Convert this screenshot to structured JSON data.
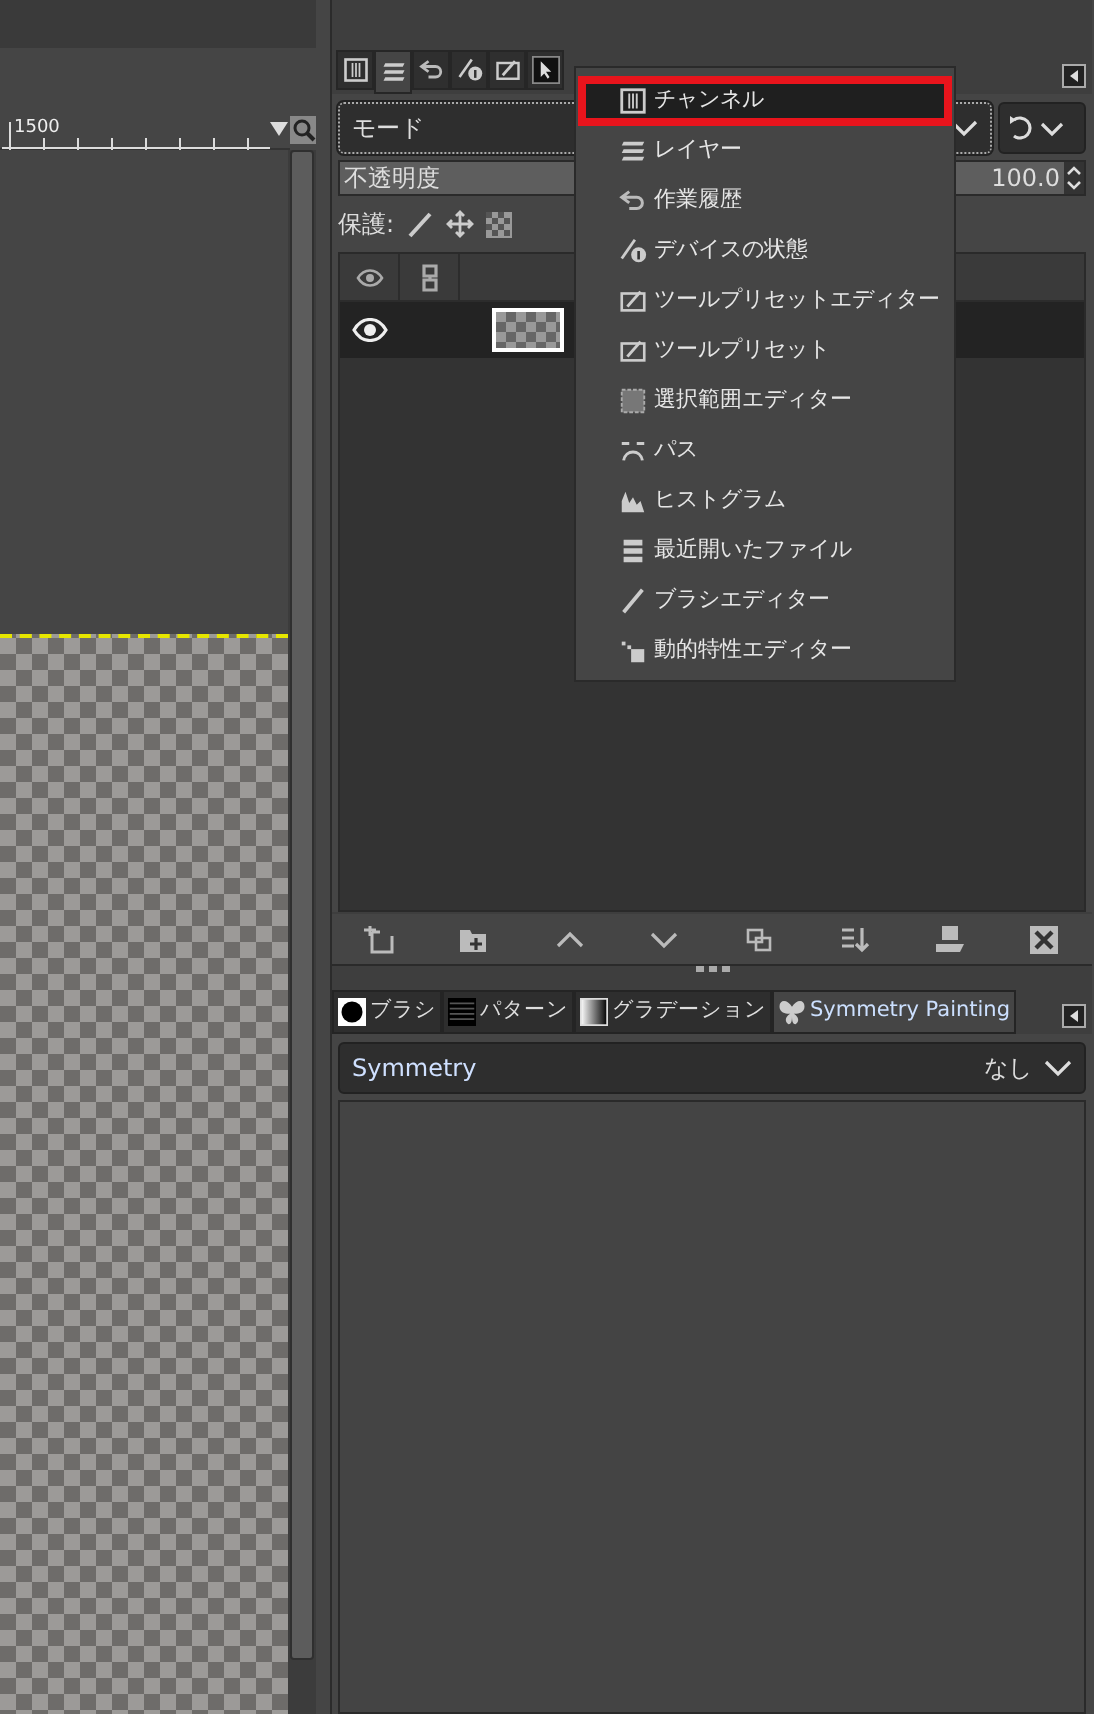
{
  "ruler": {
    "label": "1500"
  },
  "dock_tabs": [
    {
      "kind": "channels",
      "selected": false
    },
    {
      "kind": "layers",
      "selected": true
    },
    {
      "kind": "undo",
      "selected": false
    },
    {
      "kind": "device",
      "selected": false
    },
    {
      "kind": "preset",
      "selected": false
    },
    {
      "kind": "pointer",
      "selected": false
    }
  ],
  "mode_field": {
    "value": "モード"
  },
  "opacity": {
    "label": "不透明度",
    "value": "100.0",
    "level": 1.0
  },
  "lock": {
    "label": "保護:"
  },
  "layers": [
    {
      "visible": true
    }
  ],
  "dock_menu": [
    {
      "label": "チャンネル",
      "kind": "channels",
      "selected": true
    },
    {
      "label": "レイヤー",
      "kind": "layers",
      "selected": false
    },
    {
      "label": "作業履歴",
      "kind": "undo",
      "selected": false
    },
    {
      "label": "デバイスの状態",
      "kind": "device",
      "selected": false
    },
    {
      "label": "ツールプリセットエディター",
      "kind": "preset",
      "selected": false
    },
    {
      "label": "ツールプリセット",
      "kind": "preset",
      "selected": false
    },
    {
      "label": "選択範囲エディター",
      "kind": "selection",
      "selected": false
    },
    {
      "label": "パス",
      "kind": "path",
      "selected": false
    },
    {
      "label": "ヒストグラム",
      "kind": "histogram",
      "selected": false
    },
    {
      "label": "最近開いたファイル",
      "kind": "documents",
      "selected": false
    },
    {
      "label": "ブラシエディター",
      "kind": "brush",
      "selected": false
    },
    {
      "label": "動的特性エディター",
      "kind": "dynamics",
      "selected": false
    }
  ],
  "bottom_tabs": [
    {
      "label": "ブラシ",
      "kind": "brush",
      "selected": false
    },
    {
      "label": "パターン",
      "kind": "pattern",
      "selected": false
    },
    {
      "label": "グラデーション",
      "kind": "gradient",
      "selected": false
    },
    {
      "label": "Symmetry Painting",
      "kind": "symmetry",
      "selected": true
    }
  ],
  "symmetry": {
    "label": "Symmetry",
    "value": "なし"
  }
}
